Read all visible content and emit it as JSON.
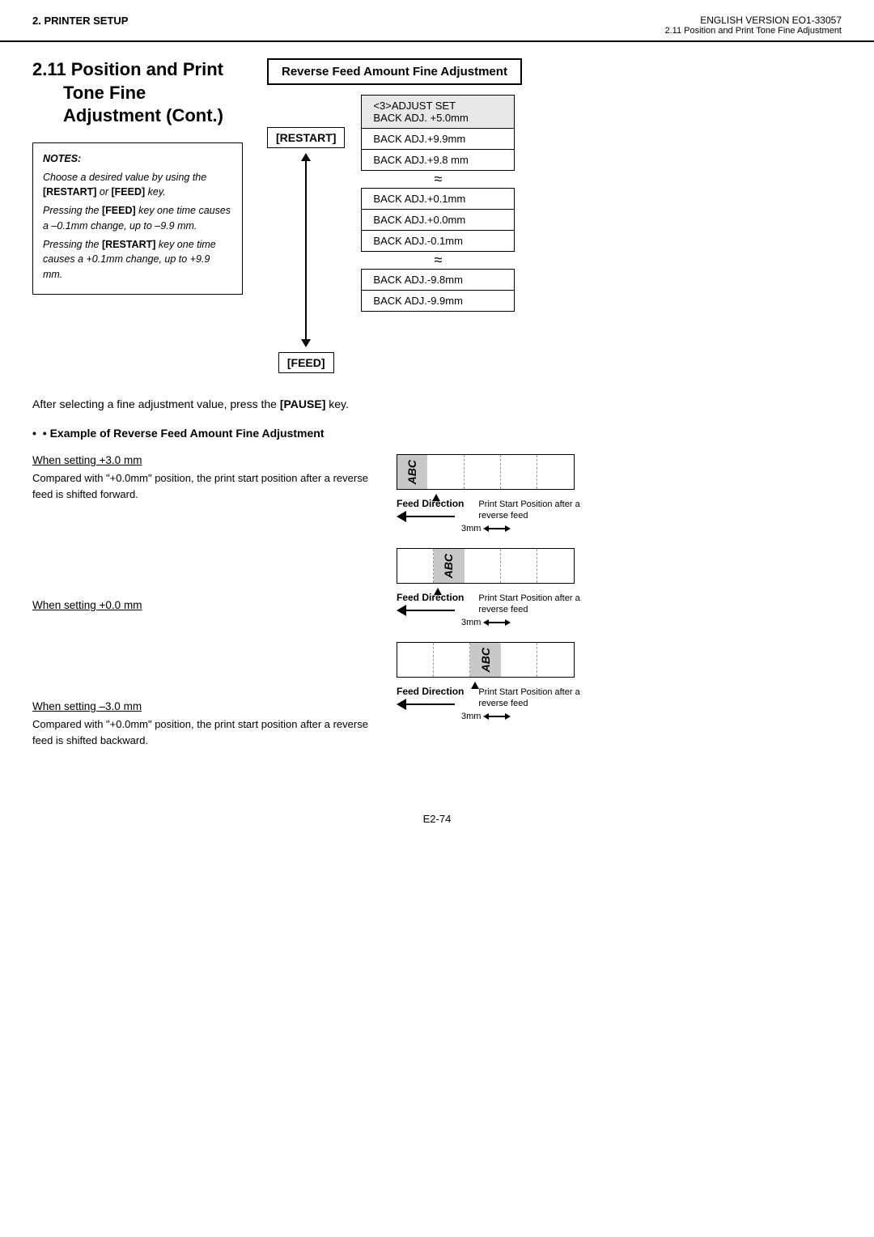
{
  "header": {
    "left": "2. PRINTER SETUP",
    "right_top": "ENGLISH VERSION EO1-33057",
    "right_bottom": "2.11 Position and Print Tone Fine Adjustment"
  },
  "section_title": {
    "number": "2.11",
    "line1": "Position and Print",
    "line2": "Tone Fine",
    "line3": "Adjustment (Cont.)"
  },
  "diagram_title": "Reverse Feed Amount Fine Adjustment",
  "notes": {
    "title": "NOTES:",
    "lines": [
      "Choose a desired value by using the [RESTART] or [FEED] key.",
      "Pressing the [FEED] key one time causes a –0.1mm change, up to –9.9 mm.",
      "Pressing the [RESTART] key one time causes a +0.1mm change, up to +9.9 mm."
    ]
  },
  "diagram": {
    "restart_label": "[RESTART]",
    "feed_label": "[FEED]",
    "menu_top": {
      "line1": "<3>ADJUST SET",
      "line2": "BACK ADJ. +5.0mm"
    },
    "menu_entries": [
      "BACK ADJ.+9.9mm",
      "BACK ADJ.+9.8 mm",
      "squiggle",
      "BACK ADJ.+0.1mm",
      "BACK ADJ.+0.0mm",
      "BACK ADJ.-0.1mm",
      "squiggle",
      "BACK ADJ.-9.8mm",
      "BACK ADJ.-9.9mm"
    ]
  },
  "after_note": "After selecting a fine adjustment value, press the [PAUSE] key.",
  "example_section": {
    "title": "• Example of Reverse Feed Amount Fine Adjustment",
    "items": [
      {
        "setting": "When setting +3.0 mm",
        "description": "Compared with \"+0.0mm\" position, the print start position after a reverse feed is shifted forward.",
        "feed_direction_label": "Feed Direction",
        "print_start_label": "Print Start Position after a reverse feed",
        "offset_label": "3mm"
      },
      {
        "setting": "When setting +0.0 mm",
        "description": "",
        "feed_direction_label": "Feed Direction",
        "print_start_label": "Print Start Position after a reverse feed",
        "offset_label": "3mm"
      },
      {
        "setting": "When setting –3.0 mm",
        "description": "Compared with \"+0.0mm\" position, the print start position after a reverse feed is shifted backward.",
        "feed_direction_label": "Feed Direction",
        "print_start_label": "Print Start Position after a reverse feed",
        "offset_label": "3mm"
      }
    ]
  },
  "footer": {
    "page": "E2-74"
  }
}
